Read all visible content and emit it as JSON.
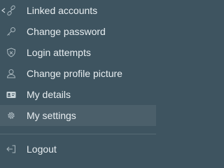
{
  "menu": {
    "items": [
      {
        "label": "Linked accounts",
        "icon": "link-icon"
      },
      {
        "label": "Change password",
        "icon": "key-icon"
      },
      {
        "label": "Login attempts",
        "icon": "shield-icon"
      },
      {
        "label": "Change profile picture",
        "icon": "user-icon"
      },
      {
        "label": "My details",
        "icon": "id-card-icon"
      },
      {
        "label": "My settings",
        "icon": "gear-icon",
        "active": true
      },
      {
        "label": "Logout",
        "icon": "logout-icon"
      }
    ]
  },
  "colors": {
    "background": "#3e5460",
    "active_background": "#4b5f6a",
    "text": "#e8eef1",
    "icon": "#a9b7be",
    "divider": "#566a75"
  }
}
